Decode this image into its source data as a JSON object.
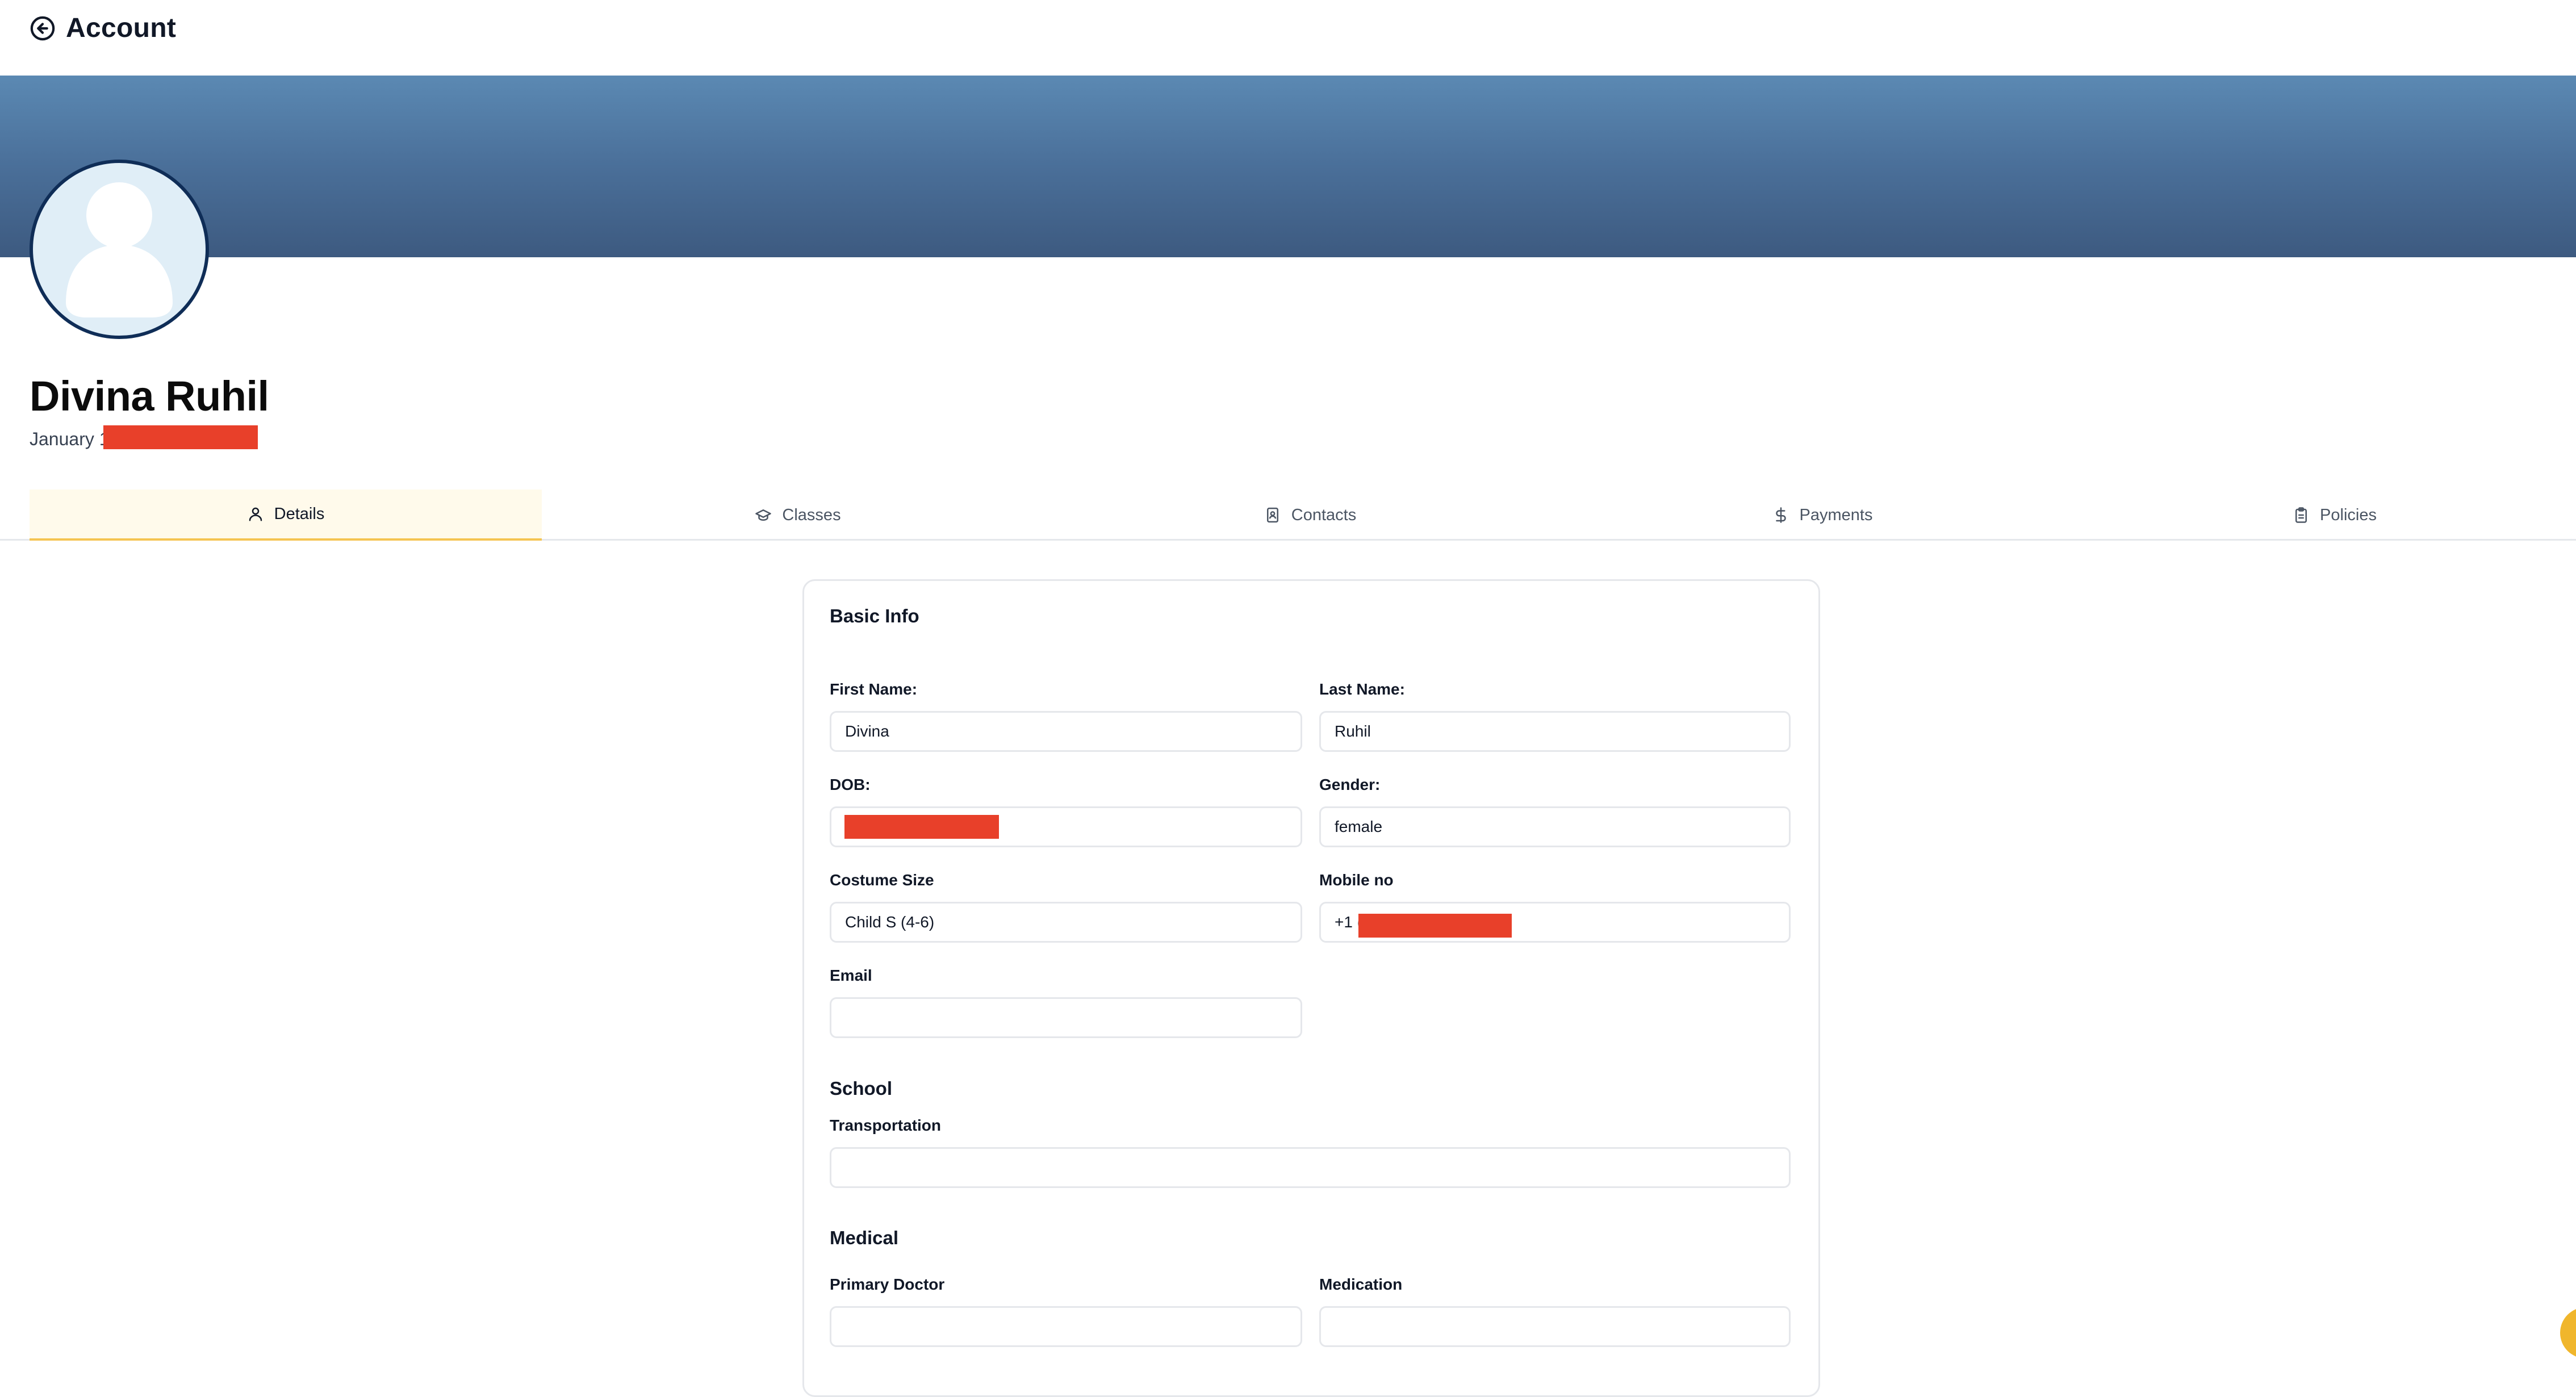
{
  "header": {
    "title": "Account",
    "back_icon": "arrow-left-circle-icon"
  },
  "profile": {
    "name": "Divina Ruhil",
    "dob_prefix": "January 1"
  },
  "tabs": [
    {
      "label": "Details",
      "icon": "user-icon",
      "active": true
    },
    {
      "label": "Classes",
      "icon": "graduation-cap-icon",
      "active": false
    },
    {
      "label": "Contacts",
      "icon": "contact-book-icon",
      "active": false
    },
    {
      "label": "Payments",
      "icon": "dollar-icon",
      "active": false
    },
    {
      "label": "Policies",
      "icon": "clipboard-icon",
      "active": false
    }
  ],
  "basic_info": {
    "title": "Basic Info",
    "first_name": {
      "label": "First Name:",
      "value": "Divina"
    },
    "last_name": {
      "label": "Last Name:",
      "value": "Ruhil"
    },
    "dob": {
      "label": "DOB:",
      "value": ""
    },
    "gender": {
      "label": "Gender:",
      "value": "female"
    },
    "costume_size": {
      "label": "Costume Size",
      "value": "Child S (4-6)"
    },
    "mobile": {
      "label": "Mobile no",
      "value": "+1 ("
    },
    "email": {
      "label": "Email",
      "value": ""
    }
  },
  "school": {
    "title": "School",
    "transportation": {
      "label": "Transportation",
      "value": ""
    }
  },
  "medical": {
    "title": "Medical",
    "primary_doctor": {
      "label": "Primary Doctor",
      "value": ""
    },
    "medication": {
      "label": "Medication",
      "value": ""
    }
  },
  "colors": {
    "banner_top": "#5b89b3",
    "banner_bottom": "#3d5a80",
    "active_tab_accent": "#f5c451",
    "redaction": "#e8402a",
    "avatar_border": "#0f2d57"
  }
}
